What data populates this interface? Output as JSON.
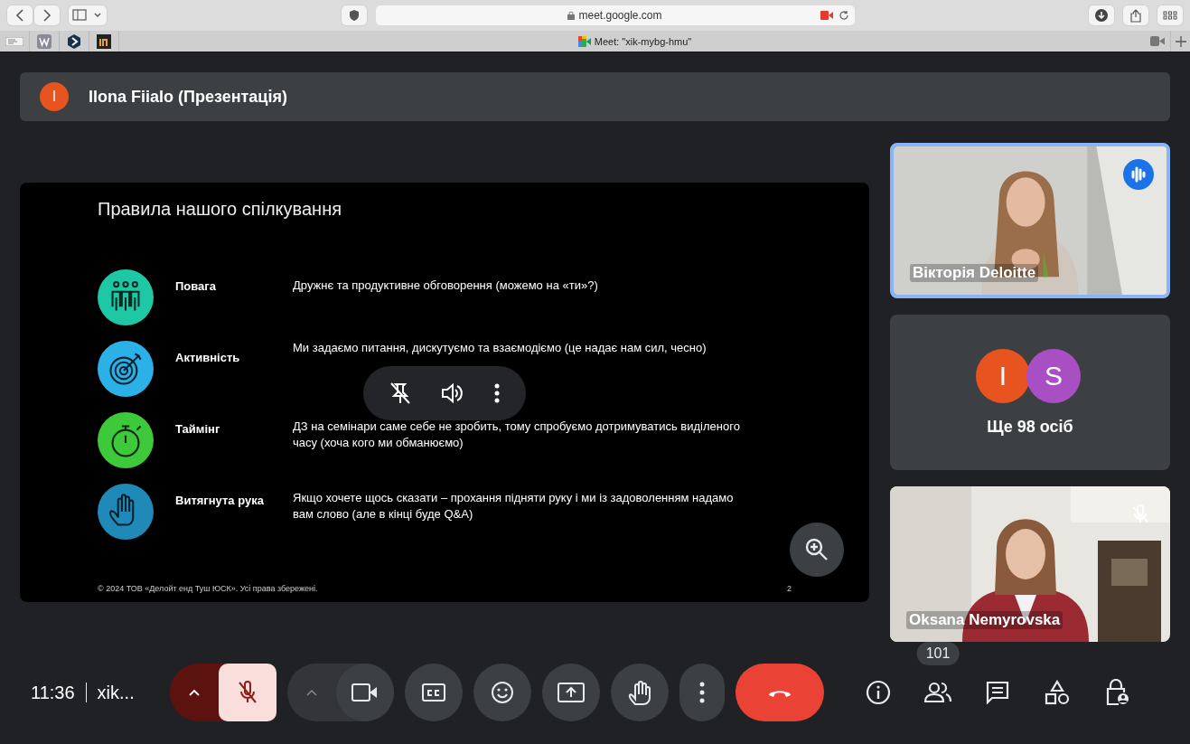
{
  "browser": {
    "url": "meet.google.com",
    "tab_title": "Meet: \"xik-mybg-hmu\""
  },
  "presenter": {
    "initial": "I",
    "color": "#e8541f",
    "name": "Ilona Fiialo (Презентація)"
  },
  "slide": {
    "title": "Правила нашого спілкування",
    "rules": [
      {
        "kind": "people",
        "color": "#1fc8a4",
        "name": "Повага",
        "text": "Дружнє та продуктивне обговорення (можемо на «ти»?)"
      },
      {
        "kind": "target",
        "color": "#2bb1e8",
        "name": "Активність",
        "text": "Ми задаємо питання, дискутуємо та взаємодіємо (це надає нам сил, чесно)"
      },
      {
        "kind": "timer",
        "color": "#3ec93a",
        "name": "Таймінг",
        "text": "ДЗ на семінари саме себе не зробить, тому спробуємо дотримуватись виділеного часу (хоча кого ми обманюємо)"
      },
      {
        "kind": "hand",
        "color": "#1f8ab8",
        "name": "Витягнута рука",
        "text": "Якщо хочете щось сказати – прохання підняти руку і ми із задоволенням надамо вам слово (але в кінці буде Q&A)"
      }
    ],
    "footer": "© 2024 ТОВ «Делойт енд Туш ЮСК». Усі права збережені.",
    "page": "2"
  },
  "tiles": [
    {
      "kind": "video",
      "name": "Вікторія Deloitte",
      "speaking": true,
      "muted": false
    },
    {
      "kind": "others",
      "avatars": [
        {
          "initial": "I",
          "color": "#e8541f"
        },
        {
          "initial": "S",
          "color": "#a94fc4"
        }
      ],
      "label": "Ще 98 осіб"
    },
    {
      "kind": "video",
      "name": "Oksana Nemyrovska",
      "speaking": false,
      "muted": true
    }
  ],
  "controls": {
    "time": "11:36",
    "meeting": "xik...",
    "mic_muted": true,
    "camera_on": true,
    "participants_count": "101"
  }
}
